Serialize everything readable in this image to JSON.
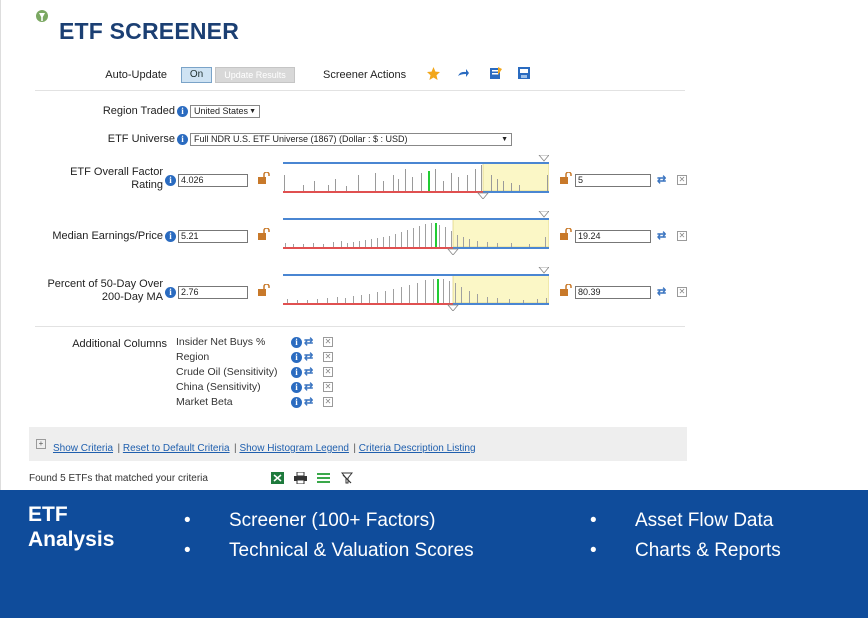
{
  "header": {
    "title": "ETF SCREENER"
  },
  "toolbar": {
    "auto_update_label": "Auto-Update",
    "on_label": "On",
    "update_results_label": "Update Results",
    "screener_actions_label": "Screener Actions"
  },
  "region": {
    "label": "Region Traded",
    "value": "United States"
  },
  "universe": {
    "label": "ETF Universe",
    "value": "Full NDR U.S. ETF Universe (1867) (Dollar : $ : USD)"
  },
  "criteria": [
    {
      "label_line1": "ETF Overall Factor",
      "label_line2": "Rating",
      "min": "4.026",
      "max": "5"
    },
    {
      "label_line1": "Median Earnings/Price",
      "label_line2": "",
      "min": "5.21",
      "max": "19.24"
    },
    {
      "label_line1": "Percent of 50-Day Over",
      "label_line2": "200-Day MA",
      "min": "2.76",
      "max": "80.39"
    }
  ],
  "additional_columns": {
    "label": "Additional Columns",
    "items": [
      "Insider Net Buys %",
      "Region",
      "Crude Oil (Sensitivity)",
      "China (Sensitivity)",
      "Market Beta"
    ]
  },
  "links": {
    "show_criteria": "Show Criteria",
    "reset": "Reset to Default Criteria",
    "histogram_legend": "Show Histogram Legend",
    "description_listing": "Criteria Description Listing"
  },
  "status": {
    "found": "Found 5 ETFs that matched your criteria"
  },
  "banner": {
    "heading_line1": "ETF",
    "heading_line2": "Analysis",
    "left_bullets": [
      "Screener (100+ Factors)",
      "Technical & Valuation Scores"
    ],
    "right_bullets": [
      "Asset Flow Data",
      "Charts & Reports"
    ],
    "background_color": "#0f4c9b"
  },
  "colors": {
    "accent_blue": "#1b3f73",
    "link_blue": "#1f5fae",
    "range_blue": "#4a86d2",
    "range_red": "#e05050",
    "highlight_yellow": "#fbf7c6",
    "marker_green": "#22cc33"
  }
}
